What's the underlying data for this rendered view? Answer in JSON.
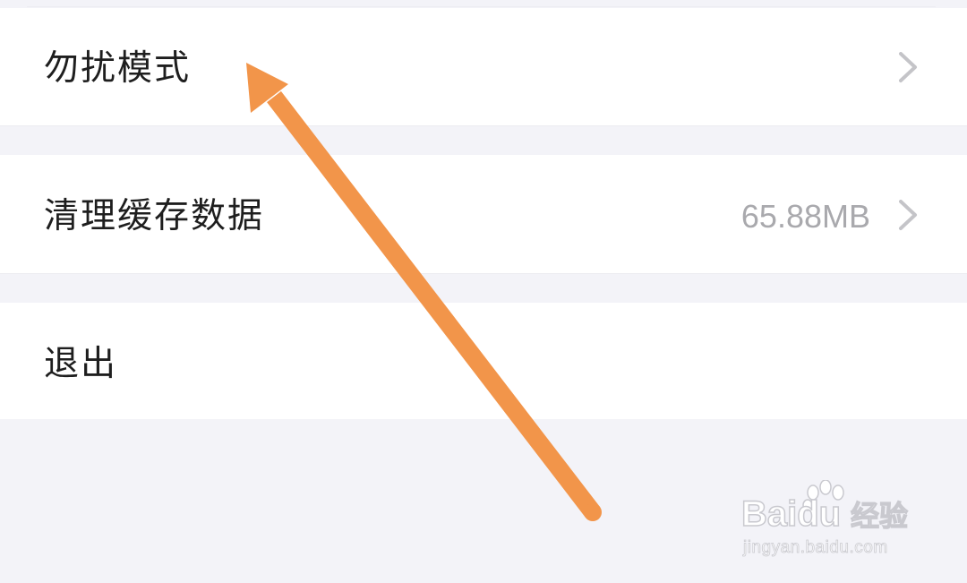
{
  "settings": {
    "items": [
      {
        "label": "勿扰模式",
        "value": "",
        "has_chevron": true
      },
      {
        "label": "清理缓存数据",
        "value": "65.88MB",
        "has_chevron": true
      },
      {
        "label": "退出",
        "value": "",
        "has_chevron": false
      }
    ]
  },
  "annotation": {
    "icon": "arrow-icon",
    "color": "#f2954a"
  },
  "watermark": {
    "brand_prefix": "Bai",
    "brand_suffix": "du",
    "product": "经验",
    "url": "jingyan.baidu.com",
    "icon": "paw-icon"
  },
  "colors": {
    "background": "#f3f3f8",
    "row_background": "#ffffff",
    "label_text": "#1e1e1e",
    "value_text": "#a9a9ad",
    "chevron": "#c4c4c8"
  }
}
